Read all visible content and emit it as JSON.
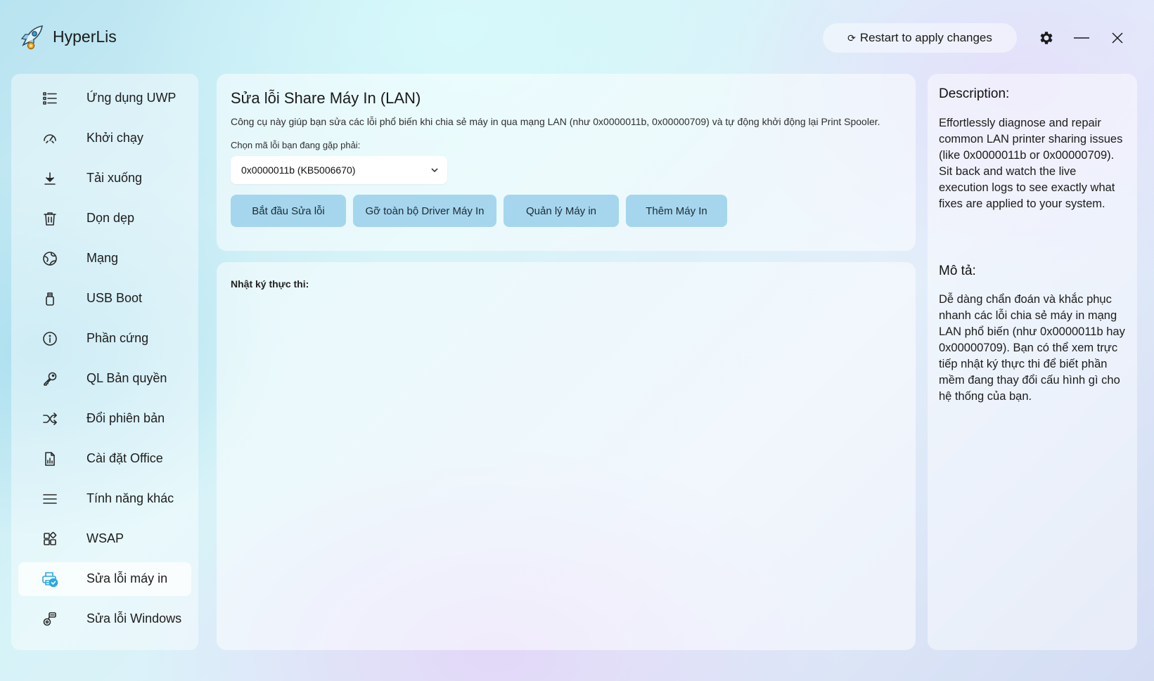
{
  "app": {
    "title": "HyperLis",
    "accent": "#2aa8e0"
  },
  "header": {
    "restart_label": "Restart to apply changes",
    "restart_icon": "refresh-icon",
    "settings_icon": "gear-icon",
    "minimize_icon": "minimize-icon",
    "close_icon": "close-icon"
  },
  "sidebar": {
    "items": [
      {
        "label": "Ứng dụng UWP",
        "icon": "list-icon"
      },
      {
        "label": "Khởi chạy",
        "icon": "gauge-icon"
      },
      {
        "label": "Tải xuống",
        "icon": "download-icon"
      },
      {
        "label": "Dọn dẹp",
        "icon": "trash-icon"
      },
      {
        "label": "Mạng",
        "icon": "globe-icon"
      },
      {
        "label": "USB Boot",
        "icon": "usb-icon"
      },
      {
        "label": "Phần cứng",
        "icon": "info-icon"
      },
      {
        "label": "QL Bản quyền",
        "icon": "key-icon"
      },
      {
        "label": "Đổi phiên bản",
        "icon": "shuffle-icon"
      },
      {
        "label": "Cài đặt Office",
        "icon": "office-doc-icon"
      },
      {
        "label": "Tính năng khác",
        "icon": "menu-icon"
      },
      {
        "label": "WSAP",
        "icon": "apps-icon"
      },
      {
        "label": "Sửa lỗi máy in",
        "icon": "printer-check-icon",
        "active": true
      },
      {
        "label": "Sửa lỗi Windows",
        "icon": "windows-repair-icon"
      }
    ]
  },
  "main": {
    "title": "Sửa lỗi Share Máy In (LAN)",
    "description": "Công cụ này giúp bạn sửa các lỗi phổ biến khi chia sẻ máy in qua mạng LAN (như 0x0000011b, 0x00000709) và tự động khởi động lại Print Spooler.",
    "error_label": "Chọn mã lỗi bạn đang gặp phải:",
    "error_selected": "0x0000011b (KB5006670)",
    "buttons": {
      "start": "Bắt đầu Sửa lỗi",
      "remove_drivers": "Gỡ toàn bộ Driver Máy In",
      "manage": "Quản lý Máy in",
      "add": "Thêm Máy In"
    },
    "log_label": "Nhật ký thực thi:"
  },
  "right_panel": {
    "desc_en_title": "Description:",
    "desc_en": "Effortlessly diagnose and repair common LAN printer sharing issues (like 0x0000011b or 0x00000709). Sit back and watch the live execution logs to see exactly what fixes are applied to your system.",
    "desc_vi_title": "Mô tả:",
    "desc_vi": "Dễ dàng chẩn đoán và khắc phục nhanh các lỗi chia sẻ máy in mạng LAN phổ biến (như 0x0000011b hay 0x00000709). Bạn có thể xem trực tiếp nhật ký thực thi để biết phần mềm đang thay đổi cấu hình gì cho hệ thống của bạn."
  }
}
